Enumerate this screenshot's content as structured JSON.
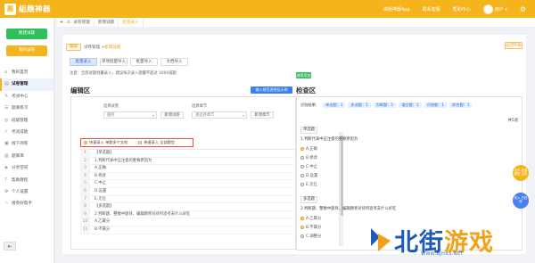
{
  "header": {
    "logo_mark": "题",
    "logo_text": "組題神器",
    "nav": [
      "綿題神器App",
      "联系客服",
      "帮助中心"
    ],
    "user": "用户"
  },
  "sidebar": {
    "btn_new": "新建试题",
    "btn_pre": "我的试卷",
    "items": [
      {
        "label": "我的首页",
        "icon": "⌂"
      },
      {
        "label": "试卷管理",
        "icon": "▤"
      },
      {
        "label": "考试中心",
        "icon": "✎"
      },
      {
        "label": "题库练习",
        "icon": "☰"
      },
      {
        "label": "班级管理",
        "icon": "◎"
      },
      {
        "label": "考试成绩",
        "icon": "✓"
      },
      {
        "label": "线下阅卷",
        "icon": "▣"
      },
      {
        "label": "题库库",
        "icon": "▥"
      },
      {
        "label": "分享空间",
        "icon": "◈"
      },
      {
        "label": "帮助教程",
        "icon": "?"
      },
      {
        "label": "个人设置",
        "icon": "⚙"
      },
      {
        "label": "组卷好帮手",
        "icon": "☆"
      }
    ]
  },
  "crumbs": {
    "tabs": [
      "试卷管理",
      "新增试题",
      "批量录入"
    ]
  },
  "main": {
    "path_tag": "编辑",
    "path_text": "试卷管理 > ",
    "path_current": "新增试题",
    "back": "返回列表",
    "mode_tabs": [
      "批量录入",
      "单项批量导入",
      "批量导入",
      "文档导入"
    ],
    "tip": "注意：全部试题批量录入，建议每次录入题量不超过 1000道题"
  },
  "edit": {
    "title": "编辑区",
    "import_btn": "输入规范说明及示例",
    "field1_label": "选择试卷",
    "field1_value": "题库",
    "new_btn": "新增试卷",
    "field2_label": "选择章节",
    "field2_placeholder": "请选择章节",
    "new_btn2": "新增章节",
    "radio1": "快速录入 单题多个文档",
    "radio2": "快速录入 全部题型",
    "lines": [
      "【单选题】",
      "1.判断代表中应注意的重要原因为",
      "A.正确",
      "B.修改",
      "C.中止",
      "D.设置",
      "E.无任",
      "【多选题】",
      "2.判断题、整数中题目、编辑教师对待所思考去什么好吃",
      "A.乙属分",
      "B.不属分"
    ]
  },
  "check": {
    "add_btn": "继续添加",
    "title": "检查区",
    "stats_label": "识别结果：",
    "stats": [
      "单选题：1",
      "多选题：1",
      "判断题：1",
      "填空题：1",
      "问答题：1",
      "综合题：1"
    ],
    "total": "共5道",
    "q1_tag": "单选题",
    "q1_text": "1.判断代表中应注意的重要原因为",
    "q1_opts": [
      "A.正确",
      "B.修改",
      "C.中止",
      "D.设置",
      "E.无任"
    ],
    "q2_tag": "多选题",
    "q2_text": "2.判断题、整数中题目、编辑教师对待所思考去什么好吃",
    "q2_opts": [
      "A.乙属分",
      "B.不属分",
      "C.调整分"
    ]
  },
  "float": {
    "a": "合并 批量题型 点击",
    "b": "录入 已校验"
  },
  "watermark": {
    "part1": "北街",
    "part2": "游戏",
    "url": "WWW.BJHXS.NET"
  }
}
